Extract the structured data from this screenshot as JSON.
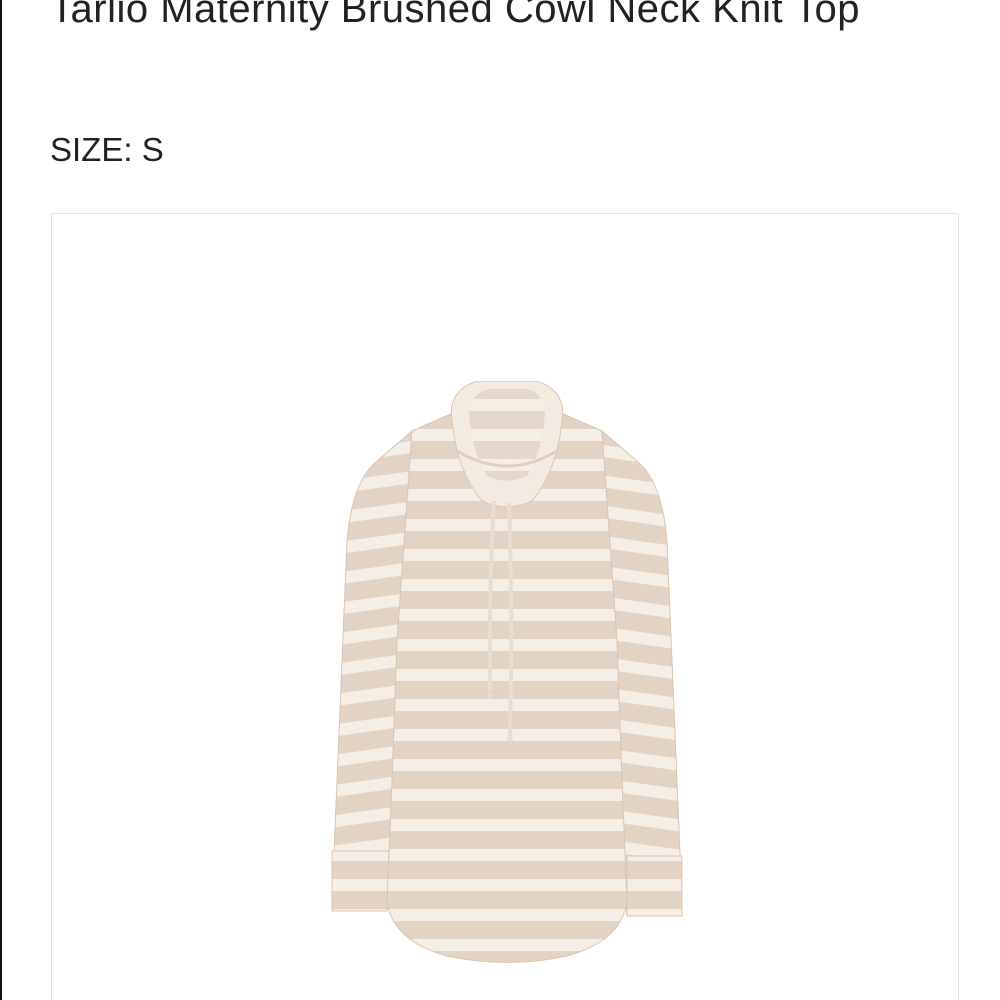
{
  "product": {
    "title": "Tarlio Maternity Brushed Cowl Neck Knit Top",
    "size_label": "SIZE:",
    "size_value": "S",
    "image_name": "striped-cowl-neck-top-image"
  },
  "colors": {
    "stripe_tan": "#e3d3c4",
    "stripe_cream": "#f5eee6",
    "text": "#222222",
    "card_border": "#e4e4e4"
  }
}
